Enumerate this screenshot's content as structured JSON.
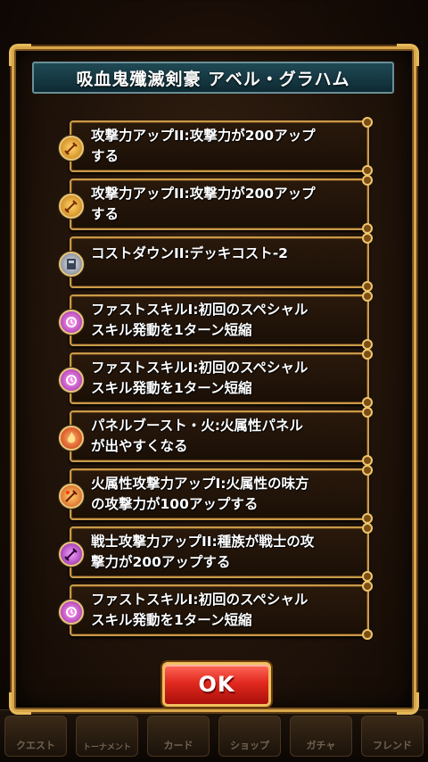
{
  "dialog": {
    "title": "吸血鬼殲滅剣豪 アベル・グラハム",
    "ok_label": "OK"
  },
  "skills": [
    {
      "text": "攻撃力アップII:攻撃力が200アップ\nする",
      "icon": "sword-attack-icon",
      "color": "#e0a020"
    },
    {
      "text": "攻撃力アップII:攻撃力が200アップ\nする",
      "icon": "sword-attack-icon",
      "color": "#e0a020"
    },
    {
      "text": "コストダウンII:デッキコスト-2",
      "icon": "cost-card-icon",
      "color": "#8a8f9c"
    },
    {
      "text": "ファストスキルI:初回のスペシャル\nスキル発動を1ターン短縮",
      "icon": "fast-skill-icon",
      "color": "#c045c0"
    },
    {
      "text": "ファストスキルI:初回のスペシャル\nスキル発動を1ターン短縮",
      "icon": "fast-skill-icon",
      "color": "#c045c0"
    },
    {
      "text": "パネルブースト・火:火属性パネル\nが出やすくなる",
      "icon": "fire-panel-icon",
      "color": "#e05a1a"
    },
    {
      "text": "火属性攻撃力アップI:火属性の味方\nの攻撃力が100アップする",
      "icon": "fire-attack-icon",
      "color": "#e08a1a"
    },
    {
      "text": "戦士攻撃力アップII:種族が戦士の攻\n撃力が200アップする",
      "icon": "warrior-attack-icon",
      "color": "#b03ac0"
    },
    {
      "text": "ファストスキルI:初回のスペシャル\nスキル発動を1ターン短縮",
      "icon": "fast-skill-icon",
      "color": "#c045c0"
    }
  ],
  "background_tabs": [
    "クエスト",
    "トーナメント",
    "カード",
    "ショップ",
    "ガチャ",
    "フレンド"
  ]
}
